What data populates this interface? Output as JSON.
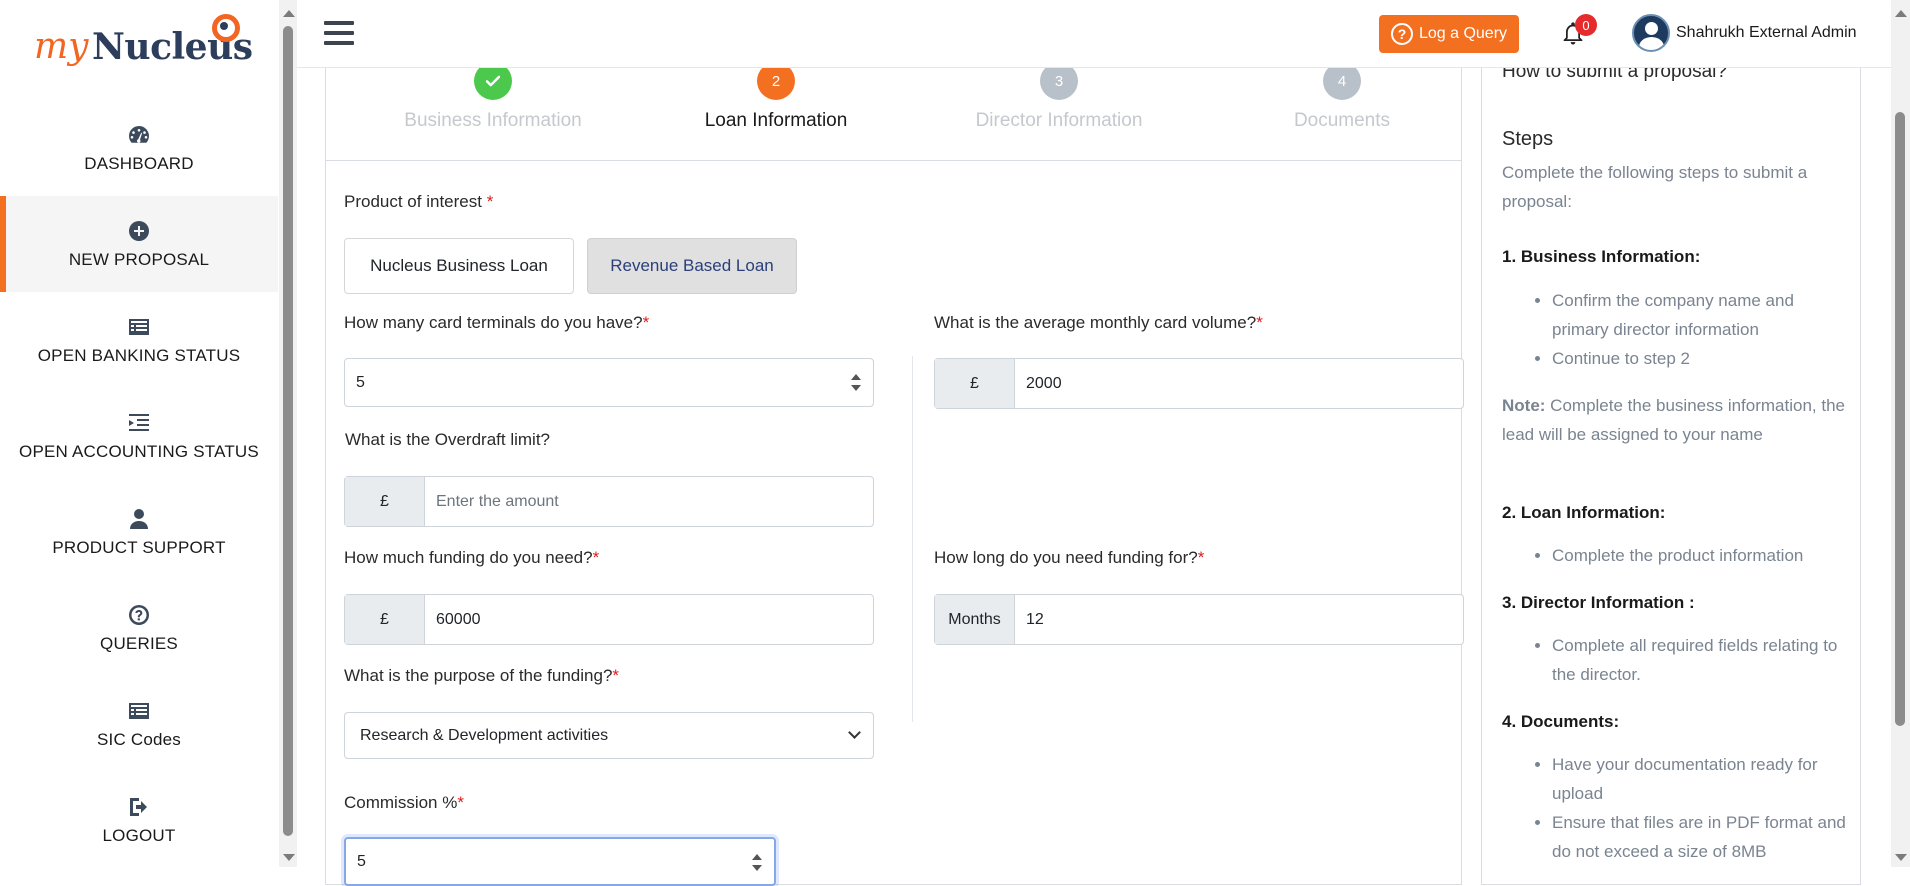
{
  "brand": {
    "my": "my",
    "nucleus": "Nucleus"
  },
  "sidebar": {
    "items": [
      {
        "label": "DASHBOARD",
        "icon": "dashboard-icon"
      },
      {
        "label": "NEW PROPOSAL",
        "icon": "plus-circle-icon",
        "active": true
      },
      {
        "label": "OPEN BANKING STATUS",
        "icon": "list-card-icon"
      },
      {
        "label": "OPEN ACCOUNTING STATUS",
        "icon": "indent-list-icon"
      },
      {
        "label": "PRODUCT SUPPORT",
        "icon": "user-icon"
      },
      {
        "label": "QUERIES",
        "icon": "question-circle-icon"
      },
      {
        "label": "SIC Codes",
        "icon": "list-card-icon"
      },
      {
        "label": "LOGOUT",
        "icon": "logout-icon"
      }
    ]
  },
  "topbar": {
    "query_label": "Log a Query",
    "notification_count": "0",
    "user_name": "Shahrukh External Admin"
  },
  "wizard": {
    "steps": [
      {
        "num": "",
        "label": "Business Information",
        "state": "done"
      },
      {
        "num": "2",
        "label": "Loan Information",
        "state": "current"
      },
      {
        "num": "3",
        "label": "Director Information",
        "state": "todo"
      },
      {
        "num": "4",
        "label": "Documents",
        "state": "todo"
      }
    ]
  },
  "form": {
    "product_label": "Product of interest ",
    "products": [
      "Nucleus Business Loan",
      "Revenue Based Loan"
    ],
    "selected_product": "Revenue Based Loan",
    "terminals_label": "How many card terminals do you have?",
    "terminals_value": "5",
    "card_volume_label": "What is the average monthly card volume?",
    "card_volume_prefix": "£",
    "card_volume_value": "2000",
    "overdraft_label": "What is the Overdraft limit?",
    "overdraft_prefix": "£",
    "overdraft_placeholder": "Enter the amount",
    "funding_label": "How much funding do you need?",
    "funding_prefix": "£",
    "funding_value": "60000",
    "duration_label": "How long do you need funding for?",
    "duration_prefix": "Months",
    "duration_value": "12",
    "purpose_label": "What is the purpose of the funding?",
    "purpose_value": "Research & Development activities",
    "commission_label": "Commission %",
    "commission_value": "5",
    "required_mark": "*"
  },
  "help": {
    "title": "How to submit a proposal?",
    "steps_heading": "Steps",
    "intro": "Complete the following steps to submit a proposal:",
    "sec1": "1. Business Information:",
    "sec1_items": [
      "Confirm the company name and primary director information",
      "Continue to step 2"
    ],
    "note_label": "Note:",
    "note_text": " Complete the business information, the lead will be assigned to your name",
    "sec2": "2. Loan Information:",
    "sec2_items": [
      "Complete the product information"
    ],
    "sec3": "3. Director Information :",
    "sec3_items": [
      "Complete all required fields relating to the director."
    ],
    "sec4": "4. Documents:",
    "sec4_items": [
      "Have your documentation ready for upload",
      "Ensure that files are in PDF format and do not exceed a size of 8MB"
    ]
  },
  "colors": {
    "accent": "#f37021",
    "success": "#4cc94c",
    "badge": "#e52b2b",
    "navy": "#2d3d5c"
  }
}
